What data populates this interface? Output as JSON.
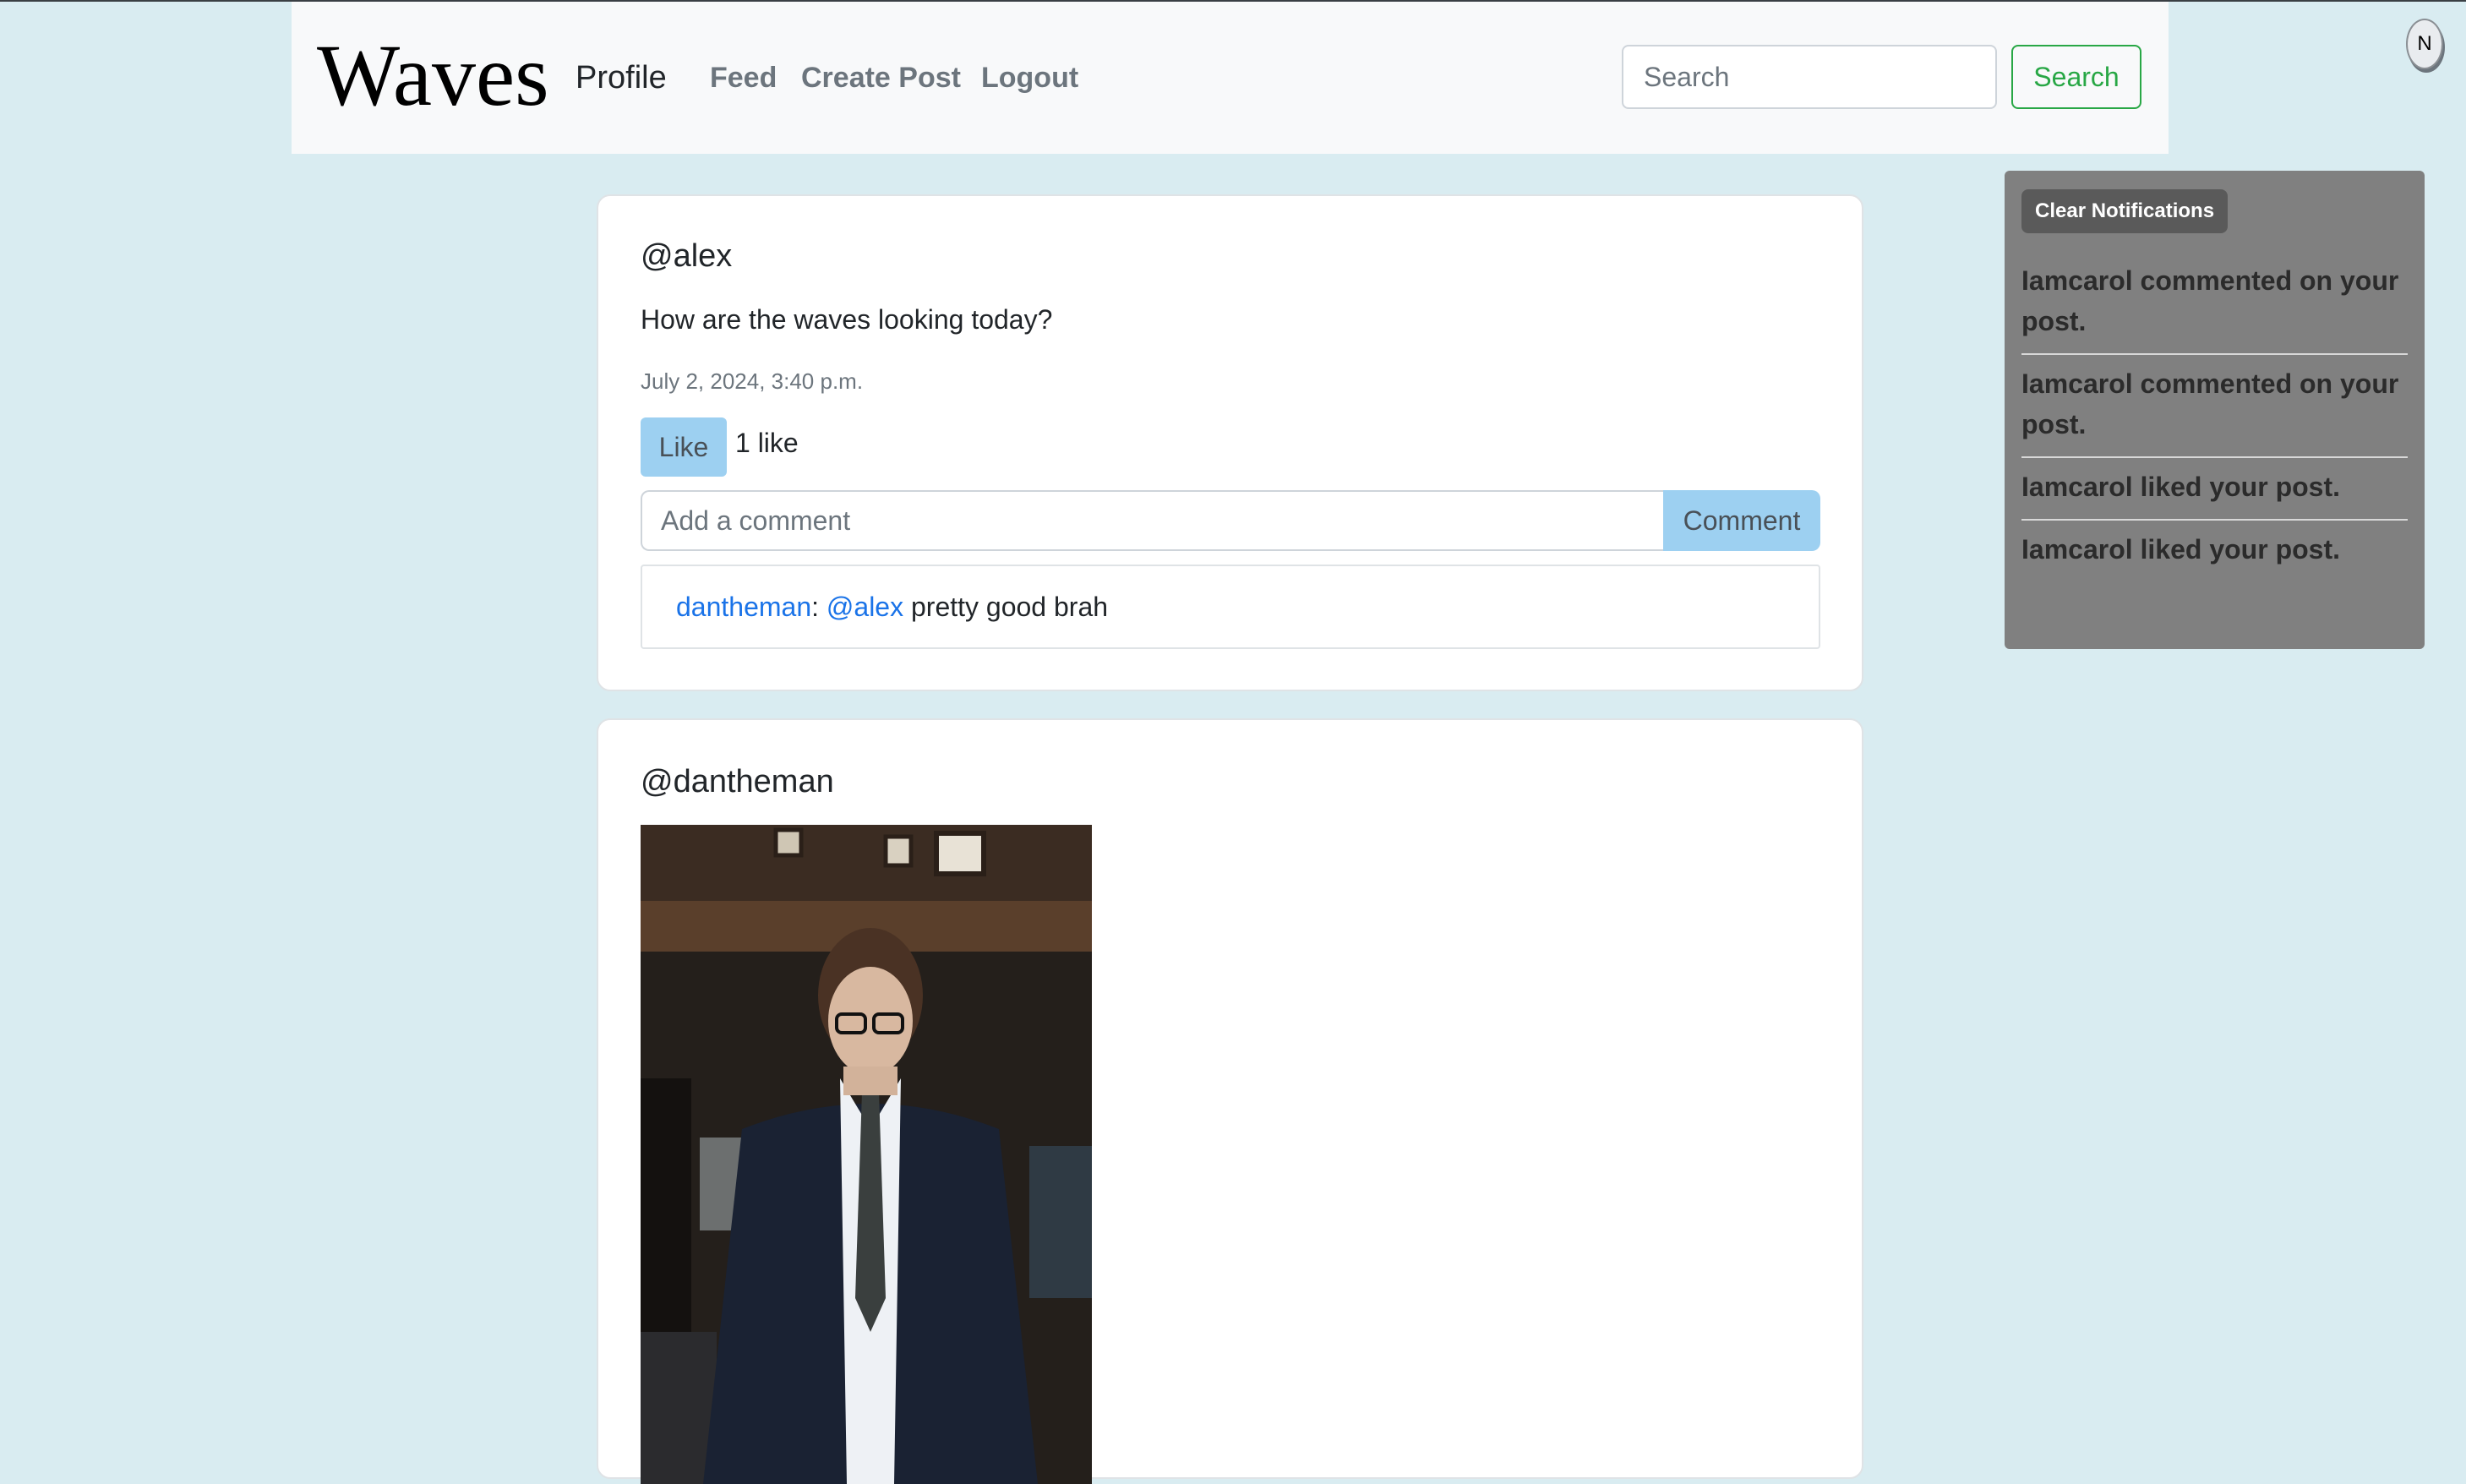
{
  "navbar": {
    "brand": "Waves",
    "links": {
      "profile": "Profile",
      "feed": "Feed",
      "create_post": "Create Post",
      "logout": "Logout"
    },
    "search": {
      "placeholder": "Search",
      "button_label": "Search"
    }
  },
  "notifications": {
    "toggle_label": "N",
    "clear_label": "Clear Notifications",
    "items": [
      "Iamcarol commented on your post.",
      "Iamcarol commented on your post.",
      "Iamcarol liked your post.",
      "Iamcarol liked your post."
    ]
  },
  "posts": [
    {
      "author": "@alex",
      "text": "How are the waves looking today?",
      "date": "July 2, 2024, 3:40 p.m.",
      "like_label": "Like",
      "like_count": "1 like",
      "comment_placeholder": "Add a comment",
      "comment_button": "Comment",
      "comments": [
        {
          "user": "dantheman",
          "separator": ":",
          "mention": "@alex",
          "text": "pretty good brah"
        }
      ]
    },
    {
      "author": "@dantheman"
    }
  ],
  "colors": {
    "page_background": "#d9ecf1",
    "navbar_background": "#f8f9fa",
    "accent_button": "#9dd0f1",
    "search_green": "#28a745",
    "notification_panel": "#808080",
    "link_blue": "#1a73e8"
  }
}
